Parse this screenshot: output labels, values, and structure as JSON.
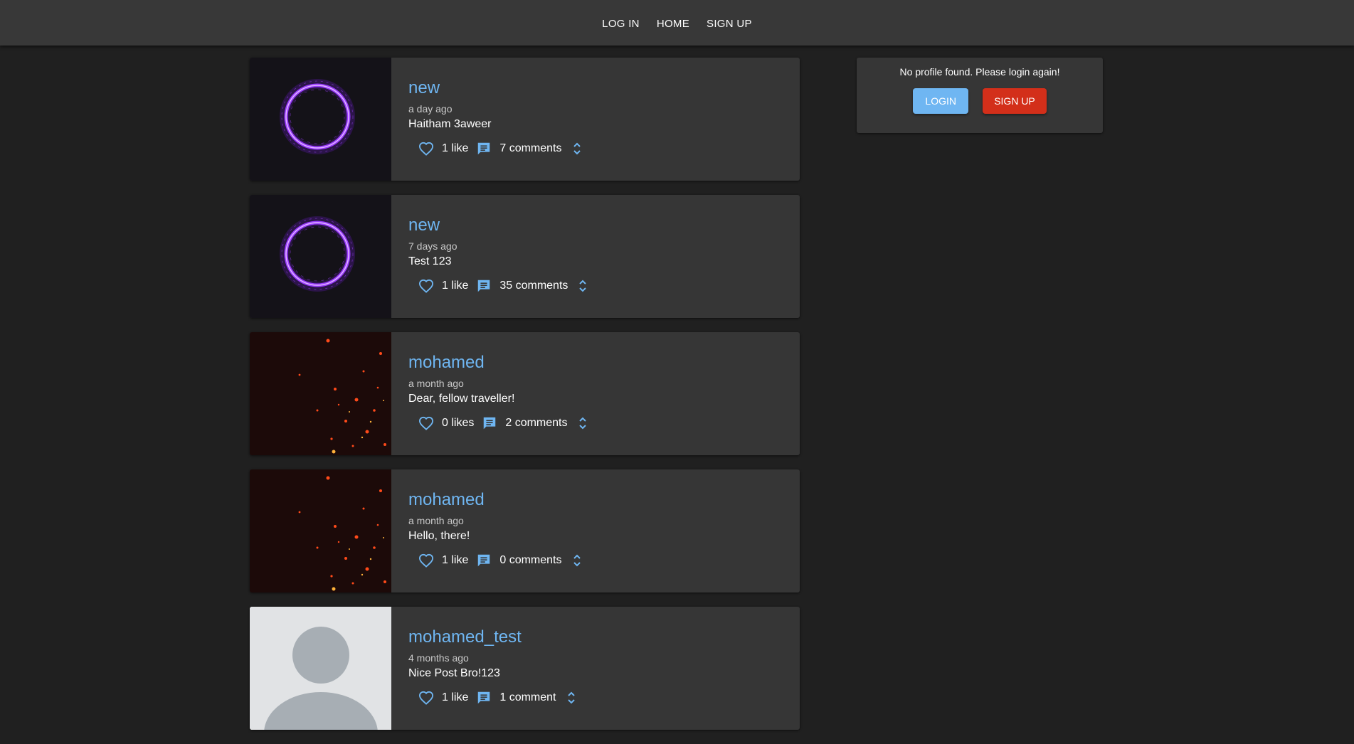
{
  "nav": {
    "log_in": "LOG IN",
    "home": "HOME",
    "sign_up": "SIGN UP"
  },
  "posts": [
    {
      "author": "new",
      "time": "a day ago",
      "text": "Haitham 3aweer",
      "likes": "1 like",
      "comments": "7 comments",
      "image": "purple-energy-ring"
    },
    {
      "author": "new",
      "time": "7 days ago",
      "text": "Test 123",
      "likes": "1 like",
      "comments": "35 comments",
      "image": "purple-energy-ring"
    },
    {
      "author": "mohamed",
      "time": "a month ago",
      "text": "Dear, fellow traveller!",
      "likes": "0 likes",
      "comments": "2 comments",
      "image": "fire-sparks"
    },
    {
      "author": "mohamed",
      "time": "a month ago",
      "text": "Hello, there!",
      "likes": "1 like",
      "comments": "0 comments",
      "image": "fire-sparks"
    },
    {
      "author": "mohamed_test",
      "time": "4 months ago",
      "text": "Nice Post Bro!123",
      "likes": "1 like",
      "comments": "1 comment",
      "image": "default-avatar"
    }
  ],
  "sidebar": {
    "message": "No profile found. Please login again!",
    "login_label": "LOGIN",
    "signup_label": "SIGN UP"
  },
  "colors": {
    "accent": "#6fb6f2",
    "danger": "#d32f1a",
    "background": "#202020",
    "card": "#363636"
  },
  "icons": {
    "like": "heart-outline-icon",
    "comment": "comment-icon",
    "expand": "unfold-more-icon"
  }
}
